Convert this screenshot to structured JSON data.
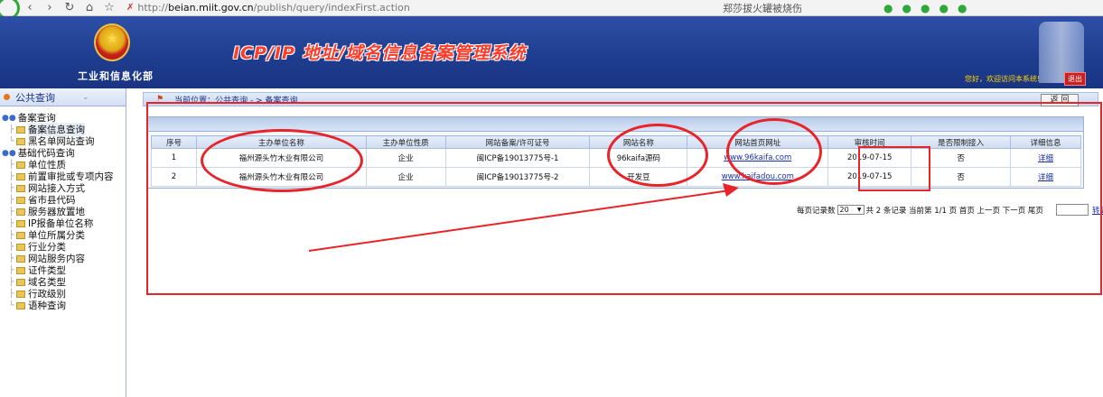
{
  "browser": {
    "url_scheme": "http://",
    "url_host": "beian.miit.gov.cn",
    "url_path": "/publish/query/indexFirst.action",
    "search_text": "郑莎拔火罐被烧伤"
  },
  "header": {
    "ministry": "工业和信息化部",
    "title": "ICP/IP 地址/域名信息备案管理系统",
    "welcome": "您好，欢迎访问本系统!",
    "logout": "退出"
  },
  "sidebar": {
    "title": "公共查询",
    "groups": [
      {
        "label": "备案查询",
        "items": [
          "备案信息查询",
          "黑名单网站查询"
        ]
      },
      {
        "label": "基础代码查询",
        "items": [
          "单位性质",
          "前置审批或专项内容",
          "网站接入方式",
          "省市县代码",
          "服务器放置地",
          "IP报备单位名称",
          "单位所属分类",
          "行业分类",
          "网站服务内容",
          "证件类型",
          "域名类型",
          "行政级别",
          "语种查询"
        ]
      }
    ]
  },
  "main": {
    "crumb": "当前位置：公共查询 - > 备案查询",
    "back": "返 回",
    "columns": [
      "序号",
      "主办单位名称",
      "主办单位性质",
      "网站备案/许可证号",
      "网站名称",
      "网站首页网址",
      "审核时间",
      "是否限制接入",
      "详细信息"
    ],
    "rows": [
      [
        "1",
        "福州源头竹木业有限公司",
        "企业",
        "闽ICP备19013775号-1",
        "96kaifa源码",
        "www.96kaifa.com",
        "2019-07-15",
        "否",
        "详细"
      ],
      [
        "2",
        "福州源头竹木业有限公司",
        "企业",
        "闽ICP备19013775号-2",
        "开发豆",
        "www.kaifadou.com",
        "2019-07-15",
        "否",
        "详细"
      ]
    ],
    "pager": {
      "per_page_label": "每页记录数",
      "per_page_value": "20",
      "summary": "共 2 条记录 当前第 1/1 页 首页 上一页 下一页 尾页",
      "jump": "转到"
    }
  },
  "colors": {
    "accent": "#1e3c8e",
    "annotation": "#e8242a",
    "title": "#ff3b2a"
  }
}
